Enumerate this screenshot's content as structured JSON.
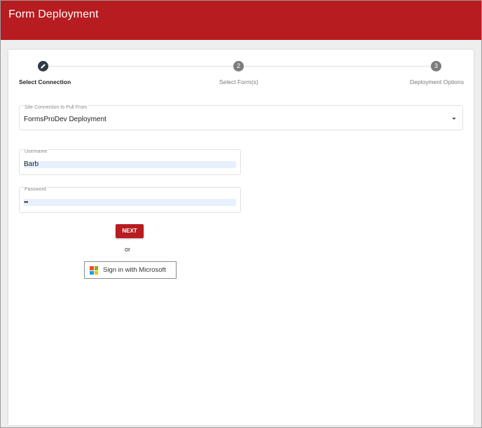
{
  "header": {
    "title": "Form Deployment"
  },
  "stepper": {
    "steps": [
      {
        "number": "",
        "label": "Select Connection",
        "state": "active",
        "icon": "pencil-icon"
      },
      {
        "number": "2",
        "label": "Select Form(s)",
        "state": "inactive"
      },
      {
        "number": "3",
        "label": "Deployment Options",
        "state": "inactive"
      }
    ]
  },
  "connection": {
    "label": "Site Connection to Pull From",
    "value": "FormsProDev Deployment"
  },
  "username": {
    "label": "Username",
    "value": "Barb"
  },
  "password": {
    "label": "Password",
    "value": "•••"
  },
  "actions": {
    "next_label": "NEXT",
    "or_label": "or",
    "microsoft_label": "Sign in with Microsoft"
  },
  "colors": {
    "brand": "#b71c20",
    "step_active": "#2f3a47",
    "step_inactive": "#7c7c7c",
    "autofill": "#e8f0fe",
    "ms_red": "#f25022",
    "ms_green": "#7fba00",
    "ms_blue": "#00a4ef",
    "ms_yellow": "#ffb900"
  }
}
